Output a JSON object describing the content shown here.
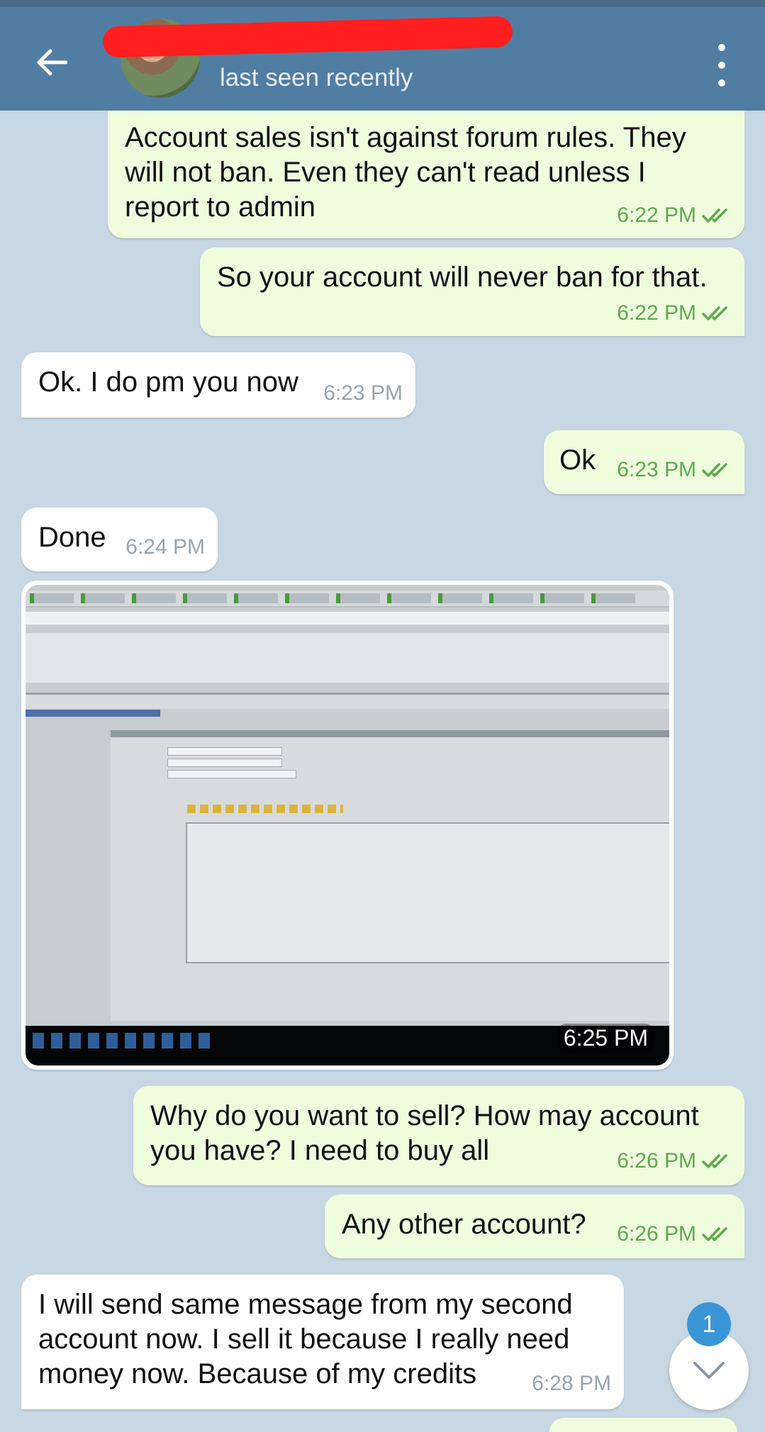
{
  "header": {
    "contact_name": "",
    "status": "last seen recently"
  },
  "messages": [
    {
      "dir": "out",
      "text": "Account sales isn't against forum rules. They will not ban. Even they can't read unless I report to admin",
      "time": "6:22 PM",
      "read": true
    },
    {
      "dir": "out",
      "text": "So your account will never ban for that.",
      "time": "6:22 PM",
      "read": true
    },
    {
      "dir": "in",
      "text": "Ok. I do pm you now",
      "time": "6:23 PM"
    },
    {
      "dir": "out",
      "text": "Ok",
      "time": "6:23 PM",
      "read": true
    },
    {
      "dir": "in",
      "text": "Done",
      "time": "6:24 PM"
    },
    {
      "dir": "in",
      "type": "photo",
      "time": "6:25 PM"
    },
    {
      "dir": "out",
      "text": "Why do you want to sell? How may account you have? I need to buy all",
      "time": "6:26 PM",
      "read": true
    },
    {
      "dir": "out",
      "text": "Any other account?",
      "time": "6:26 PM",
      "read": true
    },
    {
      "dir": "in",
      "text": "I will send same message from my second account now. I sell it because I really need money now. Because of my credits",
      "time": "6:28 PM"
    }
  ],
  "unread_count": "1",
  "icons": {
    "back": "arrow-left-icon",
    "menu": "more-vertical-icon",
    "read_status": "double-check-icon",
    "scroll_down": "chevron-down-icon"
  },
  "colors": {
    "header_bg": "#527da3",
    "outgoing_bubble": "#effdde",
    "incoming_bubble": "#ffffff",
    "chat_bg": "#c7d7e3",
    "badge": "#3a95d6",
    "read_check": "#5fa84f"
  }
}
